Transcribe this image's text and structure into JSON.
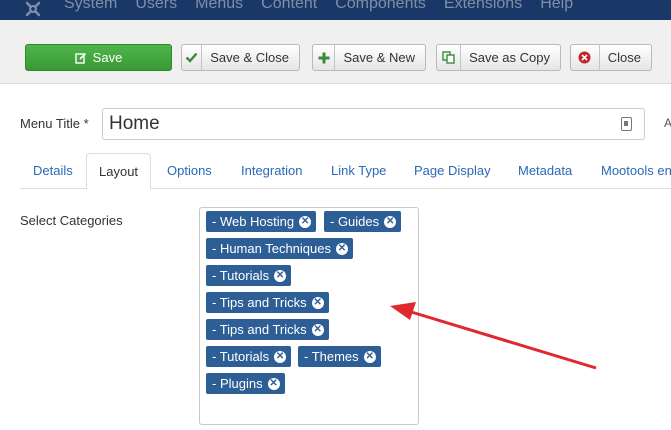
{
  "topbar": {
    "menu": [
      "System",
      "Users",
      "Menus",
      "Content",
      "Components",
      "Extensions",
      "Help"
    ]
  },
  "toolbar": {
    "save": "Save",
    "save_close": "Save & Close",
    "save_new": "Save & New",
    "save_copy": "Save as Copy",
    "close": "Close"
  },
  "form": {
    "menu_title_label": "Menu Title *",
    "menu_title_value": "Home",
    "edge_char": "A"
  },
  "tabs": [
    "Details",
    "Layout",
    "Options",
    "Integration",
    "Link Type",
    "Page Display",
    "Metadata",
    "Mootools en"
  ],
  "categories": {
    "label": "Select Categories",
    "selected": [
      "- Web Hosting",
      "- Guides",
      "- Human Techniques",
      "- Tutorials",
      "- Tips and Tricks",
      "- Tips and Tricks",
      "- Tutorials",
      "- Themes",
      "- Plugins"
    ]
  },
  "colors": {
    "topbar": "#1a3867",
    "save_green": "#3a9a36",
    "chip_blue": "#2d5f96",
    "link_blue": "#2a69b8",
    "arrow_red": "#e0282e"
  }
}
